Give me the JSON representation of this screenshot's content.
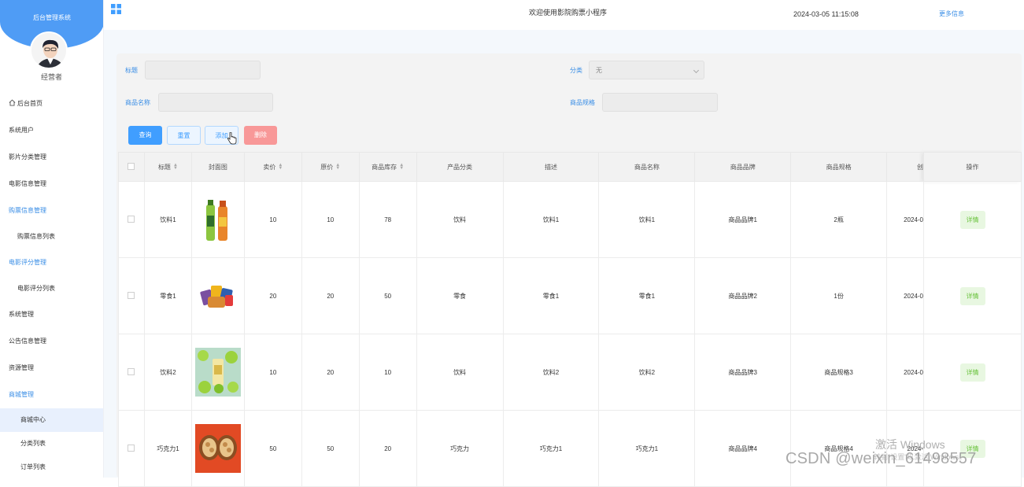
{
  "sidebar": {
    "title": "后台管理系统",
    "role": "经营者",
    "items": [
      {
        "label": "后台首页",
        "icon": "home-icon"
      },
      {
        "label": "系统用户"
      },
      {
        "label": "影片分类管理"
      },
      {
        "label": "电影信息管理"
      },
      {
        "label": "购票信息管理"
      },
      {
        "label": "购票信息列表"
      },
      {
        "label": "电影评分管理"
      },
      {
        "label": "电影评分列表"
      },
      {
        "label": "系统管理"
      },
      {
        "label": "公告信息管理"
      },
      {
        "label": "资源管理"
      },
      {
        "label": "商城管理"
      },
      {
        "label": "商城中心"
      },
      {
        "label": "分类列表"
      },
      {
        "label": "订单列表"
      }
    ]
  },
  "header": {
    "menu_icon": "grid-icon",
    "welcome": "欢迎使用影院购票小程序",
    "datetime": "2024-03-05 11:15:08",
    "more": "更多信息"
  },
  "search": {
    "title_label": "标题",
    "title_value": "",
    "category_label": "分类",
    "category_value": "无",
    "name_label": "商品名称",
    "name_value": "",
    "spec_label": "商品规格",
    "spec_value": ""
  },
  "buttons": {
    "query": "查询",
    "reset": "重置",
    "add": "添加",
    "delete": "删除"
  },
  "table": {
    "columns": [
      "标题",
      "封面图",
      "卖价",
      "原价",
      "商品库存",
      "产品分类",
      "描述",
      "商品名称",
      "商品品牌",
      "商品规格",
      "创",
      "操作"
    ],
    "rows": [
      {
        "title": "饮料1",
        "price": "10",
        "orig": "10",
        "stock": "78",
        "cat": "饮料",
        "desc": "饮料1",
        "name": "饮料1",
        "brand": "商品品牌1",
        "spec": "2瓶",
        "created": "2024-0",
        "action": "详情"
      },
      {
        "title": "零食1",
        "price": "20",
        "orig": "20",
        "stock": "50",
        "cat": "零食",
        "desc": "零食1",
        "name": "零食1",
        "brand": "商品品牌2",
        "spec": "1份",
        "created": "2024-0",
        "action": "详情"
      },
      {
        "title": "饮料2",
        "price": "10",
        "orig": "20",
        "stock": "10",
        "cat": "饮料",
        "desc": "饮料2",
        "name": "饮料2",
        "brand": "商品品牌3",
        "spec": "商品规格3",
        "created": "2024-0",
        "action": "详情"
      },
      {
        "title": "巧克力1",
        "price": "50",
        "orig": "50",
        "stock": "20",
        "cat": "巧克力",
        "desc": "巧克力1",
        "name": "巧克力1",
        "brand": "商品品牌4",
        "spec": "商品规格4",
        "created": "2024-",
        "action": "详情"
      }
    ]
  },
  "watermarks": {
    "activate": "激活 Windows",
    "activate_sub": "转到\"设置\"以激活 Windows。",
    "csdn": "CSDN @weixin_61498557"
  }
}
